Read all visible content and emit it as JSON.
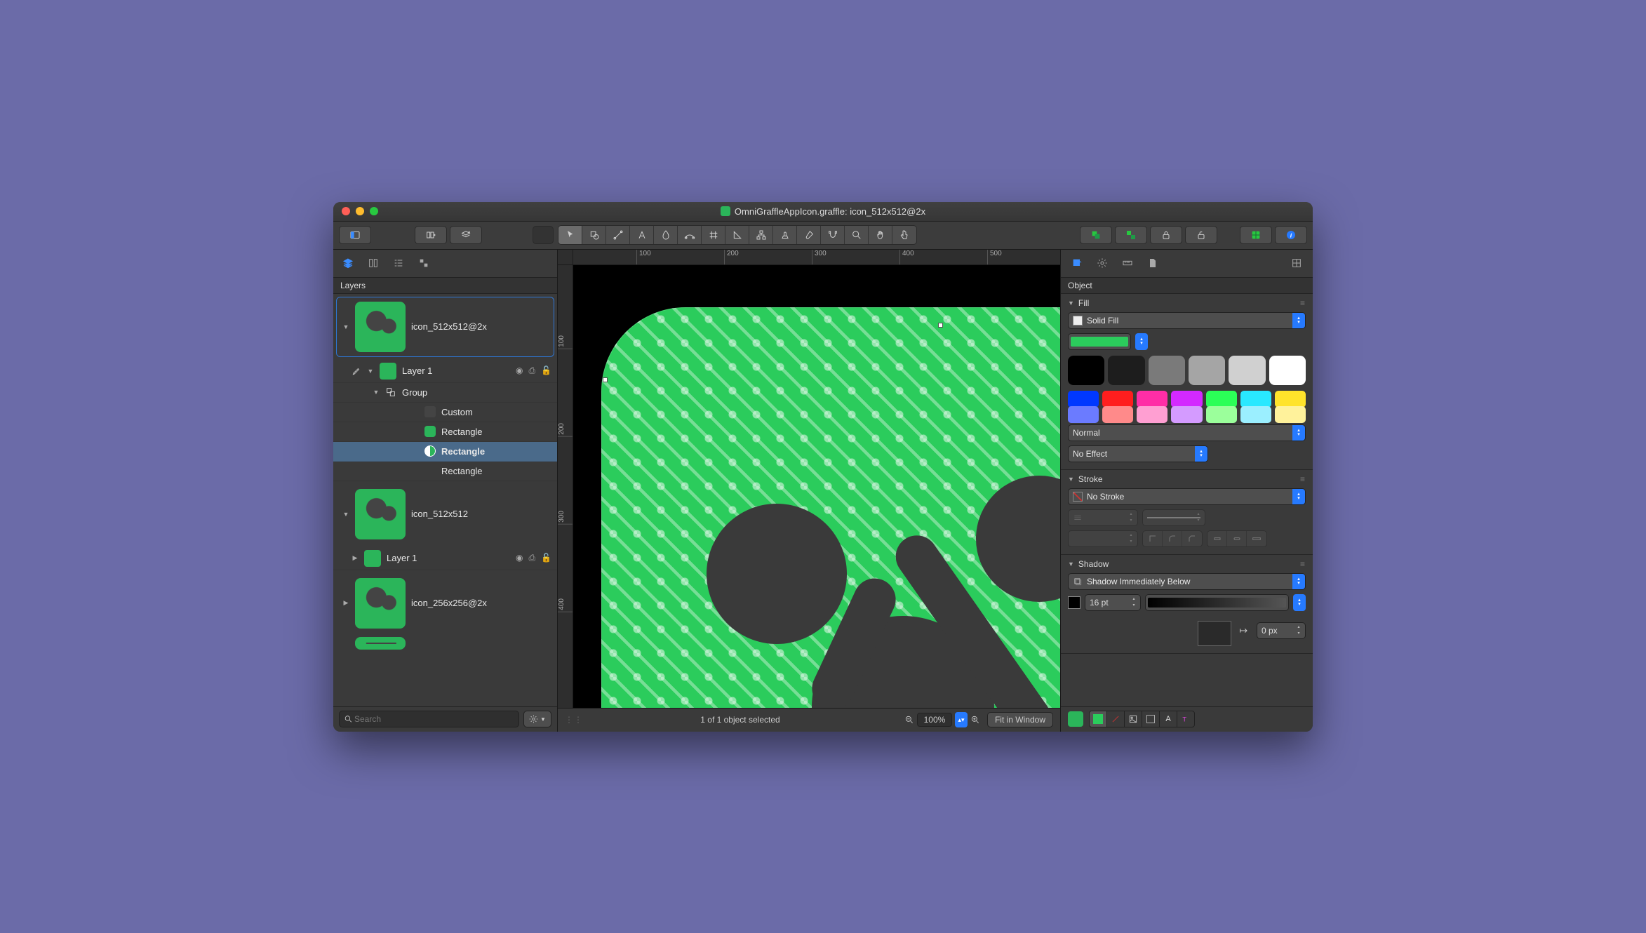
{
  "window": {
    "title": "OmniGraffleAppIcon.graffle: icon_512x512@2x"
  },
  "sidebar": {
    "panel_title": "Layers",
    "search_placeholder": "Search",
    "tree": {
      "canvas1": {
        "name": "icon_512x512@2x"
      },
      "layer1": {
        "name": "Layer 1"
      },
      "group": {
        "name": "Group"
      },
      "item_custom": {
        "name": "Custom"
      },
      "item_rect1": {
        "name": "Rectangle"
      },
      "item_rect2": {
        "name": "Rectangle"
      },
      "item_rect3": {
        "name": "Rectangle"
      },
      "canvas2": {
        "name": "icon_512x512"
      },
      "layer2": {
        "name": "Layer 1"
      },
      "canvas3": {
        "name": "icon_256x256@2x"
      }
    }
  },
  "canvas": {
    "ruler_h": [
      "100",
      "200",
      "300",
      "400",
      "500"
    ],
    "ruler_v": [
      "100",
      "200",
      "300",
      "400"
    ],
    "status": "1 of 1 object selected",
    "zoom": "100%",
    "fit_label": "Fit in Window"
  },
  "inspector": {
    "panel_title": "Object",
    "fill": {
      "title": "Fill",
      "type": "Solid Fill",
      "blend": "Normal",
      "effect": "No Effect",
      "current_color": "#2bcc5c",
      "grays": [
        "#000000",
        "#1d1d1d",
        "#7a7a7a",
        "#a5a5a5",
        "#d0d0d0",
        "#ffffff"
      ],
      "colors_row1": [
        "#0038ff",
        "#ff1e1e",
        "#ff2ea6",
        "#d329ff",
        "#2bff57",
        "#29e8ff",
        "#ffe32b"
      ],
      "colors_row2": [
        "#6b7bff",
        "#ff8a8a",
        "#ff9fd2",
        "#d49bff",
        "#9bff9b",
        "#9befff",
        "#fff29b"
      ]
    },
    "stroke": {
      "title": "Stroke",
      "type": "No Stroke"
    },
    "shadow": {
      "title": "Shadow",
      "type": "Shadow Immediately Below",
      "blur": "16 pt",
      "offset": "0 px"
    }
  }
}
